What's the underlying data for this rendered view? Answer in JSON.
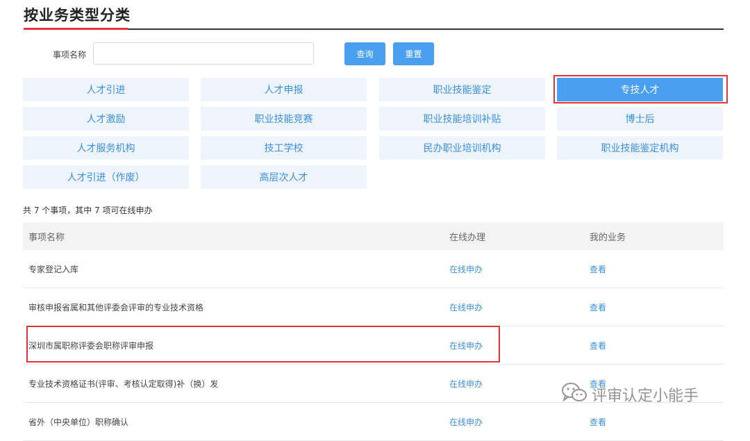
{
  "page": {
    "title": "按业务类型分类"
  },
  "search": {
    "label": "事项名称",
    "value": "",
    "placeholder": "",
    "query_label": "查询",
    "reset_label": "重置"
  },
  "categories": [
    {
      "label": "人才引进",
      "active": false
    },
    {
      "label": "人才申报",
      "active": false
    },
    {
      "label": "职业技能鉴定",
      "active": false
    },
    {
      "label": "专技人才",
      "active": true
    },
    {
      "label": "人才激励",
      "active": false
    },
    {
      "label": "职业技能竞赛",
      "active": false
    },
    {
      "label": "职业技能培训补贴",
      "active": false
    },
    {
      "label": "博士后",
      "active": false
    },
    {
      "label": "人才服务机构",
      "active": false
    },
    {
      "label": "技工学校",
      "active": false
    },
    {
      "label": "民办职业培训机构",
      "active": false
    },
    {
      "label": "职业技能鉴定机构",
      "active": false
    },
    {
      "label": "人才引进（作废）",
      "active": false
    },
    {
      "label": "高层次人才",
      "active": false
    }
  ],
  "summary": "共 7 个事项，其中 7 项可在线申办",
  "table": {
    "headers": [
      "事项名称",
      "在线办理",
      "我的业务"
    ],
    "rows": [
      {
        "name": "专家登记入库",
        "apply": "在线申办",
        "view": "查看"
      },
      {
        "name": "审核申报省属和其他评委会评审的专业技术资格",
        "apply": "在线申办",
        "view": "查看"
      },
      {
        "name": "深圳市属职称评委会职称评审申报",
        "apply": "在线申办",
        "view": "查看"
      },
      {
        "name": "专业技术资格证书(评审、考核认定取得)补（换）发",
        "apply": "在线申办",
        "view": "查看"
      },
      {
        "name": "省外（中央单位）职称确认",
        "apply": "在线申办",
        "view": "查看"
      }
    ]
  },
  "watermark": {
    "text": "评审认定小能手",
    "icon": "wechat-icon"
  },
  "colors": {
    "accent": "#4a9ff0",
    "link": "#3d8fd8",
    "highlight": "#e0343a",
    "title_rule_accent": "#e8343a"
  }
}
